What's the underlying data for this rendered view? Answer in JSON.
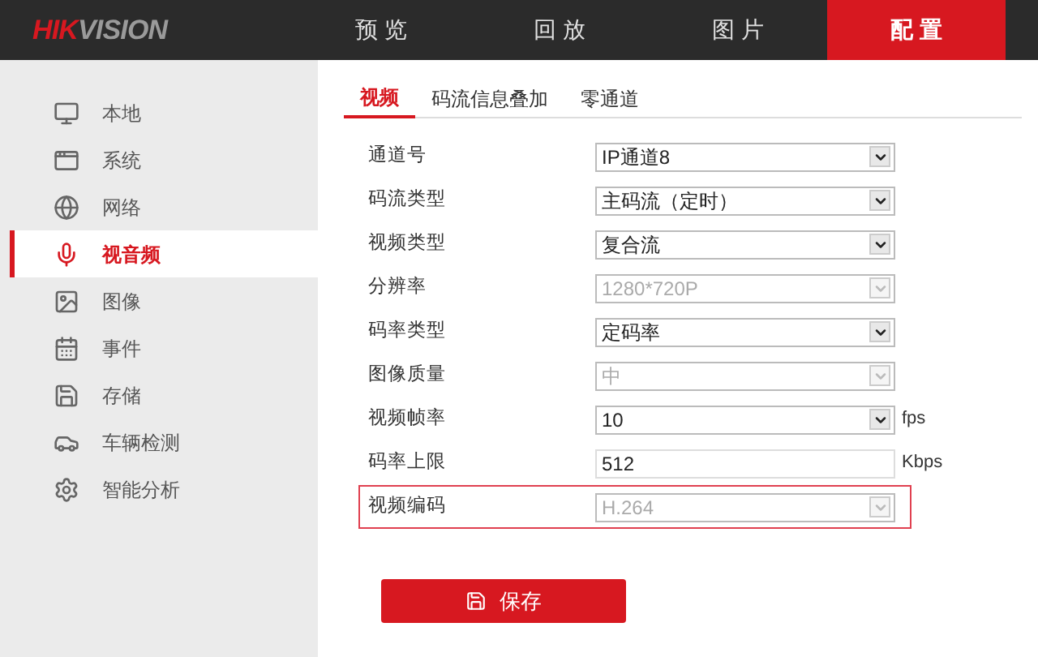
{
  "logo": {
    "part_1": "HIK",
    "part_2": "VISION"
  },
  "nav": [
    {
      "label": "预 览",
      "selected": false
    },
    {
      "label": "回 放",
      "selected": false
    },
    {
      "label": "图 片",
      "selected": false
    },
    {
      "label": "配 置",
      "selected": true
    }
  ],
  "sidebar": {
    "items": [
      {
        "label": "本地",
        "selected": false
      },
      {
        "label": "系统",
        "selected": false
      },
      {
        "label": "网络",
        "selected": false
      },
      {
        "label": "视音频",
        "selected": true
      },
      {
        "label": "图像",
        "selected": false
      },
      {
        "label": "事件",
        "selected": false
      },
      {
        "label": "存储",
        "selected": false
      },
      {
        "label": "车辆检测",
        "selected": false
      },
      {
        "label": "智能分析",
        "selected": false
      }
    ]
  },
  "tabs": [
    {
      "label": "视频",
      "selected": true
    },
    {
      "label": "码流信息叠加",
      "selected": false
    },
    {
      "label": "零通道",
      "selected": false
    }
  ],
  "form": [
    {
      "kind": "select",
      "label": "通道号",
      "value": "IP通道8",
      "disabled": false,
      "highlighted": false
    },
    {
      "kind": "select",
      "label": "码流类型",
      "value": "主码流（定时）",
      "disabled": false,
      "highlighted": false
    },
    {
      "kind": "select",
      "label": "视频类型",
      "value": "复合流",
      "disabled": false,
      "highlighted": false
    },
    {
      "kind": "select",
      "label": "分辨率",
      "value": "1280*720P",
      "disabled": true,
      "highlighted": false
    },
    {
      "kind": "select",
      "label": "码率类型",
      "value": "定码率",
      "disabled": false,
      "highlighted": false
    },
    {
      "kind": "select",
      "label": "图像质量",
      "value": "中",
      "disabled": true,
      "highlighted": false
    },
    {
      "kind": "select",
      "label": "视频帧率",
      "value": "10",
      "unit": "fps",
      "disabled": false,
      "highlighted": false
    },
    {
      "kind": "input",
      "label": "码率上限",
      "value": "512",
      "unit": "Kbps",
      "disabled": false,
      "highlighted": false
    },
    {
      "kind": "select",
      "label": "视频编码",
      "value": "H.264",
      "disabled": true,
      "highlighted": true
    }
  ],
  "save_button": "保存"
}
